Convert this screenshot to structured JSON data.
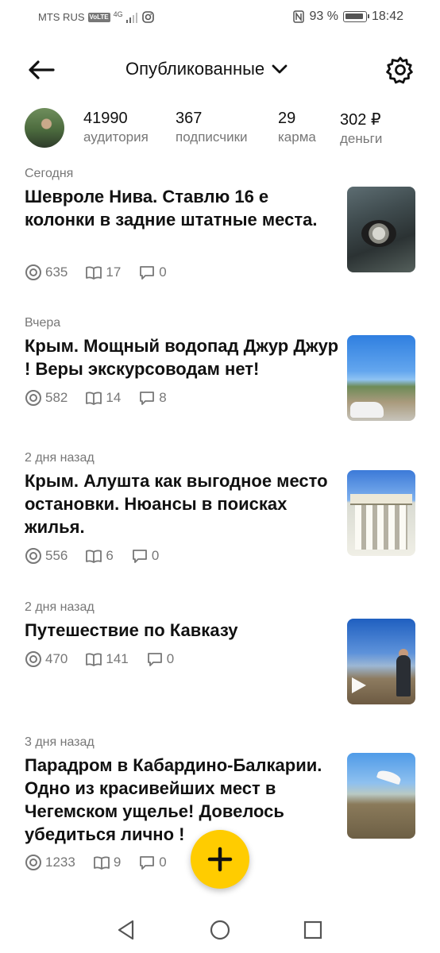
{
  "status_bar": {
    "carrier": "MTS RUS",
    "volte": "VoLTE",
    "network": "4G",
    "battery": "93 %",
    "time": "18:42"
  },
  "header": {
    "title": "Опубликованные"
  },
  "profile": {
    "stats": [
      {
        "value": "41990",
        "label": "аудитория"
      },
      {
        "value": "367",
        "label": "подписчики"
      },
      {
        "value": "29",
        "label": "карма"
      },
      {
        "value": "302 ₽",
        "label": "деньги"
      }
    ]
  },
  "posts": [
    {
      "date": "Сегодня",
      "title": "Шевроле Нива. Ставлю 16 е колонки в задние штатные места.",
      "views": "635",
      "reads": "17",
      "comments": "0",
      "video": false
    },
    {
      "date": "Вчера",
      "title": "Крым. Мощный водопад Джур Джур ! Веры экскурсоводам нет!",
      "views": "582",
      "reads": "14",
      "comments": "8",
      "video": false
    },
    {
      "date": "2 дня назад",
      "title": "Крым. Алушта как выгодное место остановки. Нюансы в поисках жилья.",
      "views": "556",
      "reads": "6",
      "comments": "0",
      "video": false
    },
    {
      "date": "2 дня назад",
      "title": "Путешествие по Кавказу",
      "views": "470",
      "reads": "141",
      "comments": "0",
      "video": true
    },
    {
      "date": "3 дня назад",
      "title": "Парадром в Кабардино-Балкарии. Одно из красивейших мест в Чегемском ущелье! Довелось убедиться лично !",
      "views": "1233",
      "reads": "9",
      "comments": "0",
      "video": false
    }
  ],
  "colors": {
    "accent": "#ffcc00",
    "text": "#111111",
    "muted": "#777777"
  },
  "icons": {
    "back": "arrow-left-icon",
    "settings": "gear-icon",
    "dropdown": "chevron-down-icon",
    "views": "eye-icon",
    "reads": "book-icon",
    "comments": "comment-icon",
    "add": "plus-icon"
  }
}
